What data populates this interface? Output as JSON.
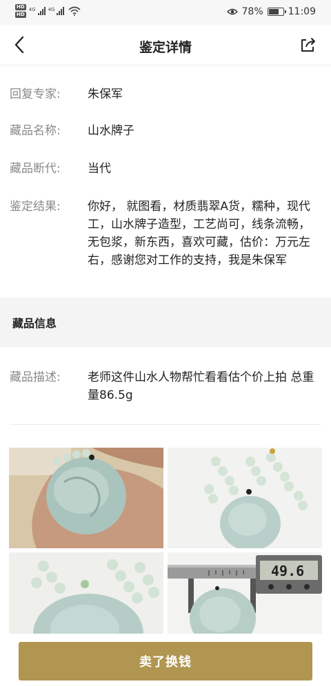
{
  "status_bar": {
    "hd_labels": [
      "HD",
      "HD"
    ],
    "signal_labels": [
      "4G",
      "4G"
    ],
    "battery_percent_text": "78%",
    "battery_level": 0.78,
    "time": "11:09",
    "icons": [
      "eye-icon",
      "battery-icon",
      "wifi-icon"
    ]
  },
  "header": {
    "title": "鉴定详情",
    "icons": [
      "back-arrow-icon",
      "share-icon"
    ]
  },
  "appraisal": {
    "expert_label": "回复专家:",
    "expert_value": "朱保军",
    "name_label": "藏品名称:",
    "name_value": "山水牌子",
    "era_label": "藏品断代:",
    "era_value": "当代",
    "result_label": "鉴定结果:",
    "result_value": "你好， 就图看，材质翡翠A货，糯种，现代工，山水牌子造型，工艺尚可，线条流畅，无包浆，新东西，喜欢可藏，估价：万元左右，感谢您对工作的支持，我是朱保军"
  },
  "collection": {
    "section_title": "藏品信息",
    "desc_label": "藏品描述:",
    "desc_value": "老师这件山水人物帮忙看看估个价上拍 总重量86.5g"
  },
  "photos": {
    "caliper_reading": "49.6"
  },
  "bottom": {
    "sell_label": "卖了换钱"
  },
  "colors": {
    "accent": "#b09651",
    "label_gray": "#8a8a8a"
  }
}
